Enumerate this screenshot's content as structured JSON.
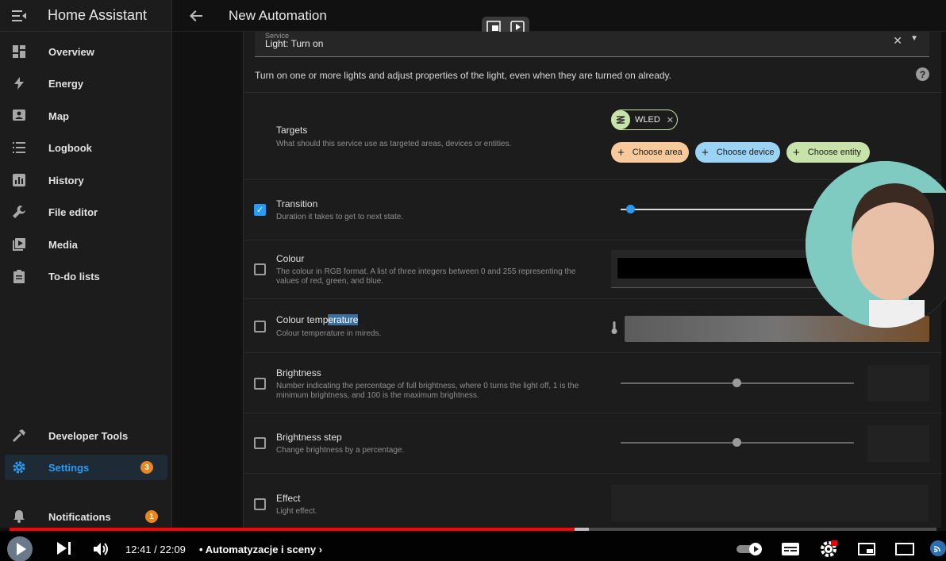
{
  "sidebar": {
    "title": "Home Assistant",
    "items": [
      {
        "label": "Overview",
        "icon": "dashboard-icon"
      },
      {
        "label": "Energy",
        "icon": "lightning-icon"
      },
      {
        "label": "Map",
        "icon": "map-icon"
      },
      {
        "label": "Logbook",
        "icon": "list-icon"
      },
      {
        "label": "History",
        "icon": "chart-icon"
      },
      {
        "label": "File editor",
        "icon": "wrench-icon"
      },
      {
        "label": "Media",
        "icon": "media-icon"
      },
      {
        "label": "To-do lists",
        "icon": "clipboard-icon"
      }
    ],
    "developer_tools": "Developer Tools",
    "settings": {
      "label": "Settings",
      "badge": "3"
    },
    "notifications": {
      "label": "Notifications",
      "badge": "1"
    }
  },
  "header": {
    "title": "New Automation"
  },
  "service": {
    "label": "Service",
    "value": "Light: Turn on",
    "description": "Turn on one or more lights and adjust properties of the light, even when they are turned on already."
  },
  "targets": {
    "title": "Targets",
    "description": "What should this service use as targeted areas, devices or entities.",
    "selected_chip": "WLED",
    "choose_area": "Choose area",
    "choose_device": "Choose device",
    "choose_entity": "Choose entity"
  },
  "fields": {
    "transition": {
      "title": "Transition",
      "description": "Duration it takes to get to next state.",
      "checked": true
    },
    "colour": {
      "title": "Colour",
      "description": "The colour in RGB format. A list of three integers between 0 and 255 representing the values of red, green, and blue."
    },
    "colour_temp": {
      "title_a": "Colour temp",
      "title_b": "erature",
      "description": "Colour temperature in mireds."
    },
    "brightness": {
      "title": "Brightness",
      "description": "Number indicating the percentage of full brightness, where 0 turns the light off, 1 is the minimum brightness, and 100 is the maximum brightness."
    },
    "brightness_step": {
      "title": "Brightness step",
      "description": "Change brightness by a percentage."
    },
    "effect": {
      "title": "Effect",
      "description": "Light effect."
    }
  },
  "video": {
    "time": "12:41 / 22:09",
    "chapter": "Automatyzacje i sceny",
    "progress": 0.61,
    "buffered": 0.625,
    "colors": {
      "progress": "#ff0000",
      "accent": "#2b9af3"
    }
  }
}
